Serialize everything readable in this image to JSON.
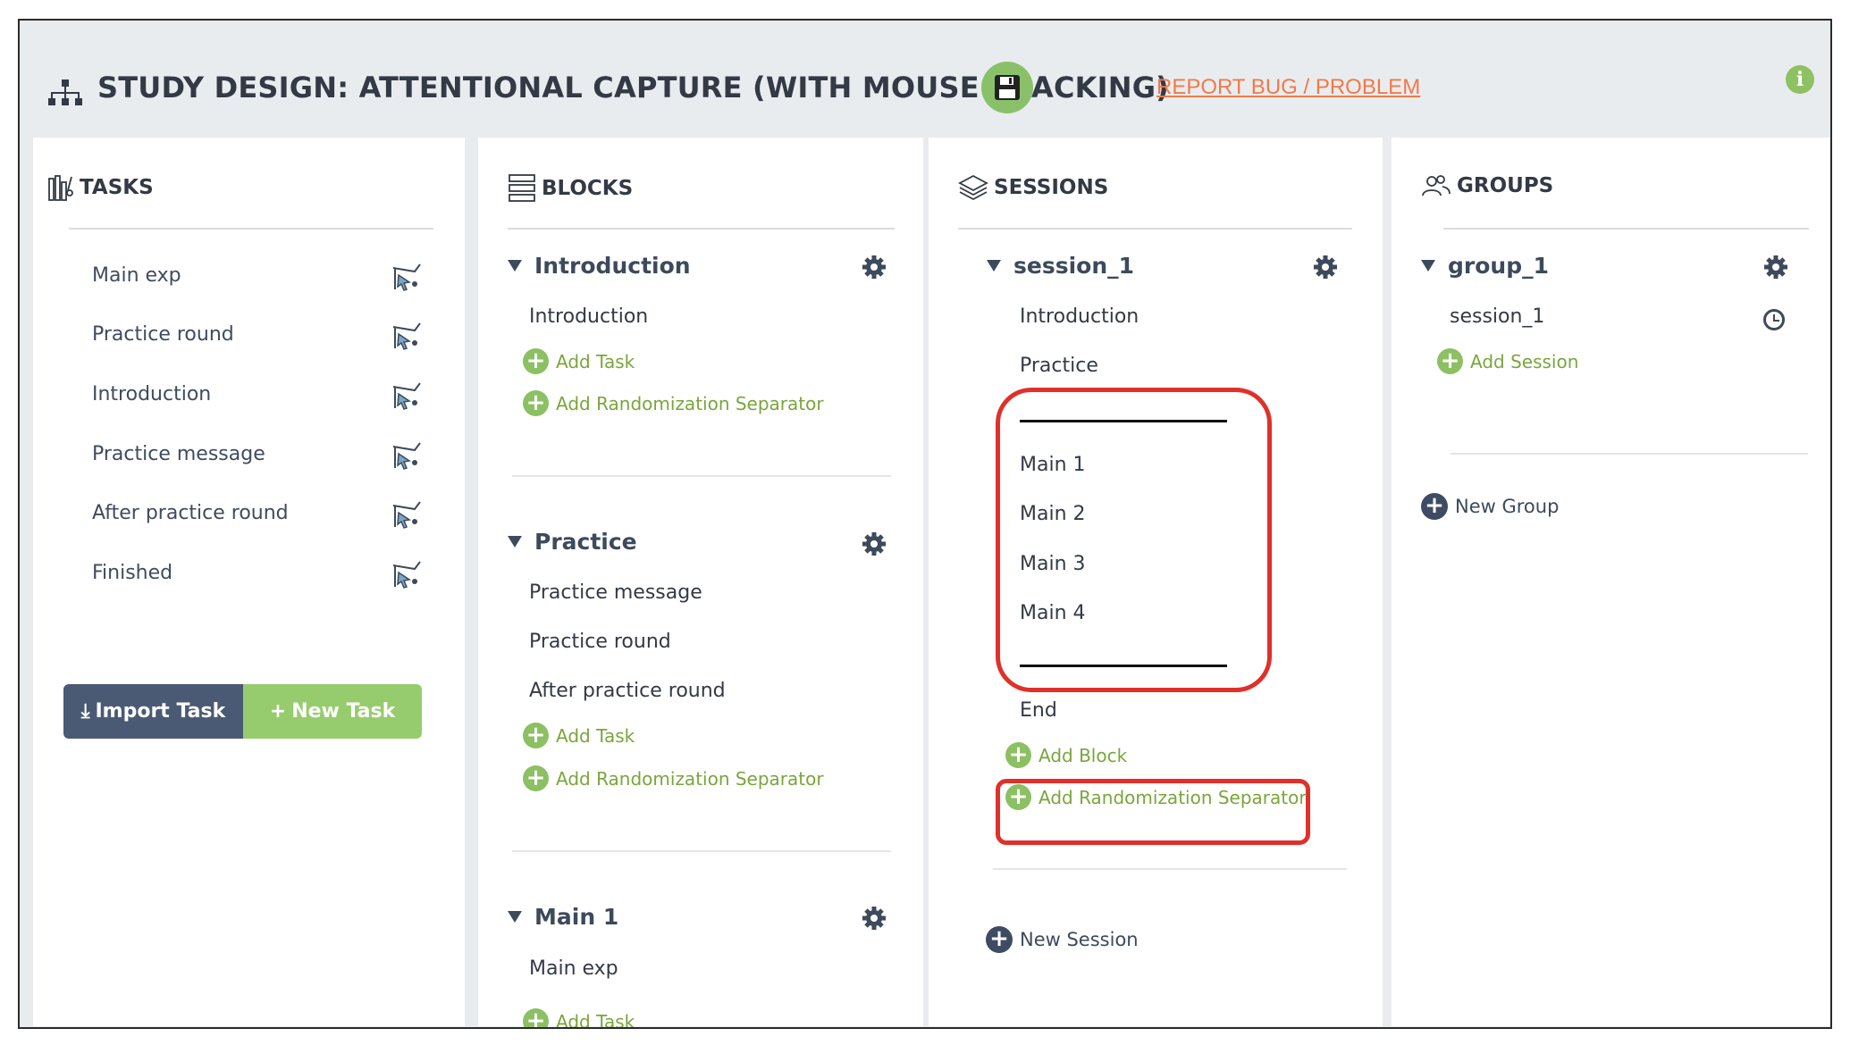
{
  "header": {
    "title": "STUDY DESIGN: ATTENTIONAL CAPTURE (WITH MOUSE TRACKING)",
    "report_link": "REPORT BUG / PROBLEM",
    "save_icon": "floppy-disk-icon",
    "info_glyph": "i"
  },
  "tasks": {
    "heading": "TASKS",
    "items": [
      {
        "label": "Main exp"
      },
      {
        "label": "Practice round"
      },
      {
        "label": "Introduction"
      },
      {
        "label": "Practice message"
      },
      {
        "label": "After practice round"
      },
      {
        "label": "Finished"
      }
    ],
    "import_label": "Import Task",
    "new_label": "New Task"
  },
  "blocks": {
    "heading": "BLOCKS",
    "groups": [
      {
        "title": "Introduction",
        "tasks": [
          "Introduction"
        ],
        "add_task": "Add Task",
        "add_sep": "Add Randomization Separator"
      },
      {
        "title": "Practice",
        "tasks": [
          "Practice message",
          "Practice round",
          "After practice round"
        ],
        "add_task": "Add Task",
        "add_sep": "Add Randomization Separator"
      },
      {
        "title": "Main 1",
        "tasks": [
          "Main exp"
        ],
        "add_task": "Add Task"
      }
    ]
  },
  "sessions": {
    "heading": "SESSIONS",
    "session": {
      "title": "session_1",
      "blocks": [
        "Introduction",
        "Practice",
        "Main 1",
        "Main 2",
        "Main 3",
        "Main 4",
        "End"
      ],
      "add_block": "Add Block",
      "add_sep": "Add Randomization Separator"
    },
    "new_session": "New Session"
  },
  "groups": {
    "heading": "GROUPS",
    "group": {
      "title": "group_1",
      "sessions": [
        "session_1"
      ],
      "add_session": "Add Session"
    },
    "new_group": "New Group"
  },
  "colors": {
    "accent_green": "#8cc063",
    "link_green": "#7aa53c",
    "dark_button": "#4b5a74",
    "report_orange": "#f07a4a",
    "highlight_red": "#e0302a"
  }
}
